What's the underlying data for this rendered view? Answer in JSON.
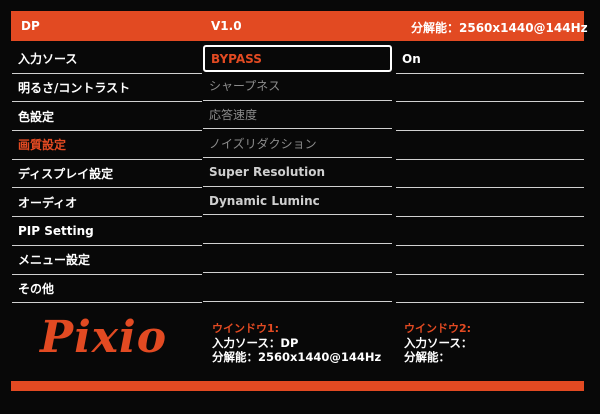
{
  "header": {
    "input": "DP",
    "version": "V1.0",
    "resolution": "分解能：2560x1440@144Hz"
  },
  "menu": {
    "items": [
      {
        "label": "入力ソース"
      },
      {
        "label": "明るさ/コントラスト"
      },
      {
        "label": "色設定"
      },
      {
        "label": "画質設定"
      },
      {
        "label": "ディスプレイ設定"
      },
      {
        "label": "オーディオ"
      },
      {
        "label": "PIP Setting"
      },
      {
        "label": "メニュー設定"
      },
      {
        "label": "その他"
      }
    ],
    "active_index": 3
  },
  "submenu": {
    "items": [
      {
        "label": "BYPASS"
      },
      {
        "label": "シャープネス"
      },
      {
        "label": "応答速度"
      },
      {
        "label": "ノイズリダクション"
      },
      {
        "label": "Super Resolution"
      },
      {
        "label": "Dynamic Luminc"
      }
    ],
    "selected_index": 0
  },
  "value_column": {
    "values": [
      "On"
    ]
  },
  "logo": {
    "text": "Pixio"
  },
  "window1": {
    "title": "ウインドウ1:",
    "input_line": "入力ソース：DP",
    "resolution_line": "分解能：2560x1440@144Hz"
  },
  "window2": {
    "title": "ウインドウ2:",
    "input_line": "入力ソース：",
    "resolution_line": "分解能："
  },
  "colors": {
    "accent": "#e24a22",
    "background": "#080808",
    "text": "#ffffff",
    "disabled_text": "#8c8c8c"
  }
}
